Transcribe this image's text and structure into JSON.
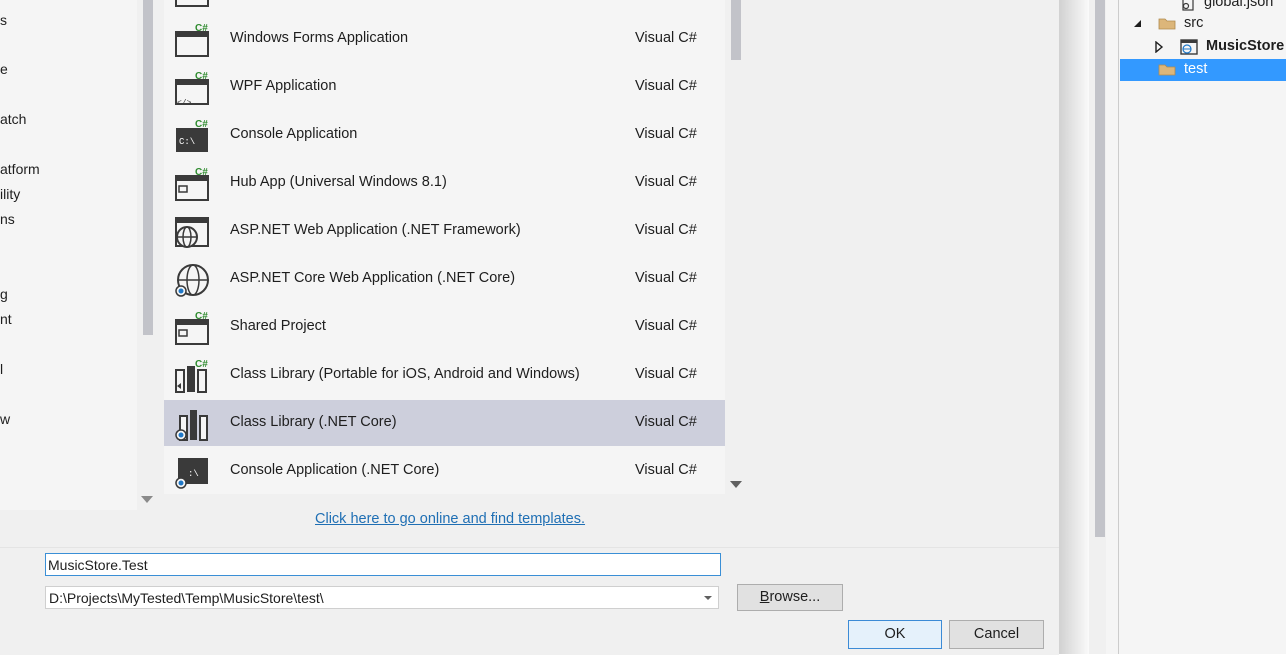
{
  "left_panel": {
    "items": [
      "s",
      "e",
      "atch",
      "atform",
      "ility",
      "ns",
      "g",
      "nt",
      "l",
      "w"
    ]
  },
  "templates": [
    {
      "name": "Windows Forms Application",
      "lang": "Visual C#",
      "icon": "windows-forms-icon"
    },
    {
      "name": "WPF Application",
      "lang": "Visual C#",
      "icon": "wpf-icon"
    },
    {
      "name": "Console Application",
      "lang": "Visual C#",
      "icon": "console-icon"
    },
    {
      "name": "Hub App (Universal Windows 8.1)",
      "lang": "Visual C#",
      "icon": "hub-app-icon"
    },
    {
      "name": "ASP.NET Web Application (.NET Framework)",
      "lang": "Visual C#",
      "icon": "web-globe-icon"
    },
    {
      "name": "ASP.NET Core Web Application (.NET Core)",
      "lang": "Visual C#",
      "icon": "core-web-globe-icon"
    },
    {
      "name": "Shared Project",
      "lang": "Visual C#",
      "icon": "shared-project-icon"
    },
    {
      "name": "Class Library (Portable for iOS, Android and Windows)",
      "lang": "Visual C#",
      "icon": "portable-library-icon"
    },
    {
      "name": "Class Library (.NET Core)",
      "lang": "Visual C#",
      "icon": "class-library-core-icon",
      "selected": true
    },
    {
      "name": "Console Application (.NET Core)",
      "lang": "Visual C#",
      "icon": "console-core-icon"
    }
  ],
  "online_link": "Click here to go online and find templates.",
  "form": {
    "name_value": "MusicStore.Test",
    "location_value": "D:\\Projects\\MyTested\\Temp\\MusicStore\\test\\",
    "browse_label": "Browse...",
    "ok_label": "OK",
    "cancel_label": "Cancel"
  },
  "solution_explorer": {
    "items": [
      {
        "label": "global.json",
        "icon": "json-file-icon"
      },
      {
        "label": "src",
        "icon": "folder-icon",
        "expanded": true
      },
      {
        "label": "MusicStore",
        "icon": "web-project-icon",
        "bold": true
      },
      {
        "label": "test",
        "icon": "folder-icon",
        "selected": true
      }
    ]
  },
  "colors": {
    "selection_row": "#cdcfdc",
    "tree_selection": "#3399ff",
    "link": "#1f6fb4",
    "csharp_badge": "#2e8b2e"
  }
}
